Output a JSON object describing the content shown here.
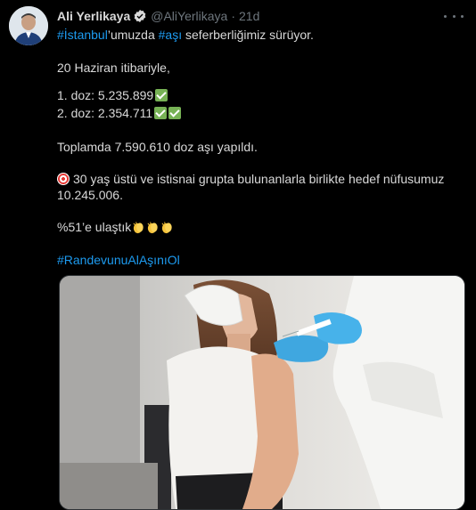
{
  "author": {
    "name": "Ali Yerlikaya",
    "handle": "@AliYerlikaya",
    "time": "21d",
    "verified": true
  },
  "tweet": {
    "line1_tag1": "#İstanbul",
    "line1_mid": "’umuzda ",
    "line1_tag2": "#aşı",
    "line1_end": " seferberliğimiz sürüyor.",
    "line2": "20 Haziran itibariyle,",
    "dose1": "1. doz: 5.235.899",
    "dose2": "2. doz: 2.354.711",
    "total": "Toplamda 7.590.610 doz aşı yapıldı.",
    "target_line1": "30 yaş üstü ve istisnai grupta bulunanlarla birlikte hedef nüfusumuz",
    "target_line2": "10.245.006.",
    "percent": "%51’e ulaştık",
    "hashtag": "#RandevunuAlAşınıOl"
  },
  "icons": {
    "verified": "verified-badge-icon",
    "more": "more-options-icon",
    "check": "check-mark-emoji",
    "target": "direct-hit-emoji",
    "clap": "clapping-hands-emoji"
  },
  "colors": {
    "background": "#000000",
    "text": "#d9d9d9",
    "muted": "#6e767d",
    "link": "#1d9bf0",
    "check": "#77b255"
  }
}
